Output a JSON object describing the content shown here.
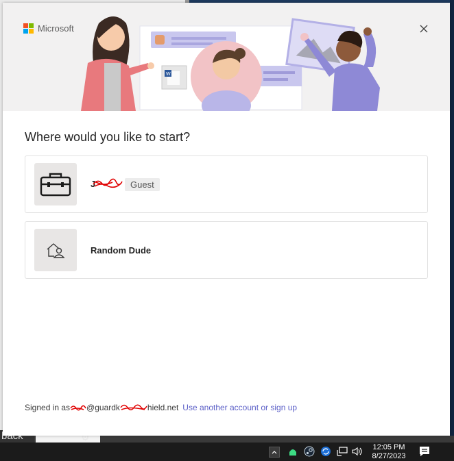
{
  "window": {
    "brand": "Microsoft",
    "brand_colors": [
      "#f25022",
      "#7fba00",
      "#00a4ef",
      "#ffb900"
    ]
  },
  "dialog": {
    "heading": "Where would you like to start?",
    "accounts": [
      {
        "name": "J",
        "badge": "Guest",
        "icon": "briefcase-icon"
      },
      {
        "name": "Random Dude",
        "icon": "home-person-icon"
      }
    ],
    "footer": {
      "signed_in_prefix": "Signed in as",
      "email_mid": "@guardk",
      "email_end": "hield.net",
      "link": "Use another account or sign up"
    }
  },
  "background": {
    "back_label": "back"
  },
  "taskbar": {
    "time": "12:05 PM",
    "date": "8/27/2023",
    "icons": [
      "chevron-up-icon",
      "android-icon",
      "steam-icon",
      "sync-icon",
      "network-icon",
      "volume-icon",
      "notifications-icon"
    ]
  },
  "colors": {
    "accent_link": "#5b5fc7",
    "redaction": "#e00000"
  }
}
